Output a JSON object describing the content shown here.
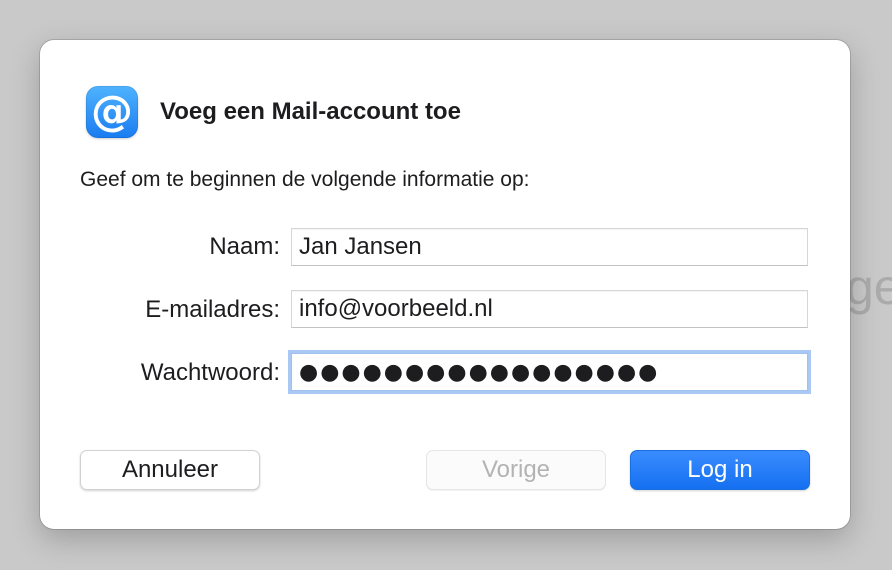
{
  "backdrop": {
    "partial_text": "ge"
  },
  "dialog": {
    "icon": "at-sign-icon",
    "icon_glyph": "@",
    "title": "Voeg een Mail-account toe",
    "subtitle": "Geef om te beginnen de volgende informatie op:",
    "fields": {
      "name": {
        "label": "Naam:",
        "value": "Jan Jansen"
      },
      "email": {
        "label": "E-mailadres:",
        "value": "info@voorbeeld.nl"
      },
      "password": {
        "label": "Wachtwoord:",
        "masked_value": "●●●●●●●●●●●●●●●●●"
      }
    },
    "buttons": {
      "cancel": "Annuleer",
      "previous": "Vorige",
      "login": "Log in"
    }
  },
  "colors": {
    "primary_button": "#1570f0",
    "focus_ring": "#a9c8f3",
    "icon_gradient_top": "#4fb3ff",
    "icon_gradient_bottom": "#1a7cf0"
  }
}
